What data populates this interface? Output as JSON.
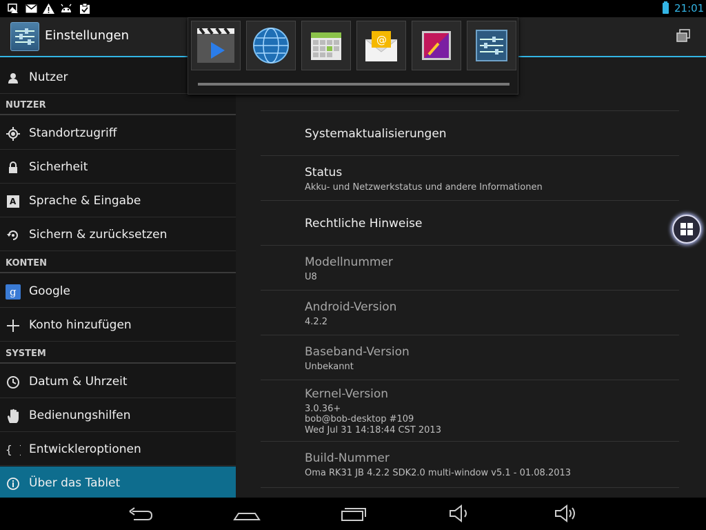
{
  "statusbar": {
    "left_icons": [
      "picture-warning-icon",
      "gmail-icon",
      "warning-icon",
      "android-icon",
      "clipboard-check-icon"
    ],
    "time": "21:01",
    "battery_color": "#33b5e5"
  },
  "actionbar": {
    "title": "Einstellungen"
  },
  "sidebar": {
    "items": [
      {
        "label": "Nutzer",
        "icon": "user-icon"
      },
      {
        "label": "Standortzugriff",
        "icon": "location-icon"
      },
      {
        "label": "Sicherheit",
        "icon": "lock-icon"
      },
      {
        "label": "Sprache & Eingabe",
        "icon": "language-icon"
      },
      {
        "label": "Sichern & zurücksetzen",
        "icon": "backup-icon"
      },
      {
        "label": "Google",
        "icon": "google-icon"
      },
      {
        "label": "Konto hinzufügen",
        "icon": "plus-icon"
      },
      {
        "label": "Datum & Uhrzeit",
        "icon": "clock-icon"
      },
      {
        "label": "Bedienungshilfen",
        "icon": "hand-icon"
      },
      {
        "label": "Entwickleroptionen",
        "icon": "braces-icon"
      },
      {
        "label": "Über das Tablet",
        "icon": "info-icon"
      }
    ],
    "sections": {
      "nutzer": "NUTZER",
      "konten": "KONTEN",
      "system": "SYSTEM"
    },
    "active_color": "#0e6d8e"
  },
  "main": {
    "rows": [
      {
        "title": "Systemaktualisierungen"
      },
      {
        "title": "Status",
        "subtitle": "Akku- und Netzwerkstatus und andere Informationen"
      },
      {
        "title": "Rechtliche Hinweise"
      },
      {
        "title": "Modellnummer",
        "subtitle": "U8"
      },
      {
        "title": "Android-Version",
        "subtitle": "4.2.2"
      },
      {
        "title": "Baseband-Version",
        "subtitle": "Unbekannt"
      },
      {
        "title": "Kernel-Version",
        "subtitle1": "3.0.36+",
        "subtitle2": "bob@bob-desktop #109",
        "subtitle3": "Wed Jul 31 14:18:44 CST 2013"
      },
      {
        "title": "Build-Nummer",
        "subtitle": "Oma RK31 JB 4.2.2 SDK2.0 multi-window v5.1 - 01.08.2013"
      }
    ]
  },
  "switcher": {
    "apps": [
      "video-player-icon",
      "browser-globe-icon",
      "calendar-icon",
      "email-icon",
      "gallery-icon",
      "settings-icon"
    ]
  },
  "navbar": {
    "buttons": [
      "back-icon",
      "home-icon",
      "recents-icon",
      "volume-down-icon",
      "volume-up-icon"
    ]
  }
}
